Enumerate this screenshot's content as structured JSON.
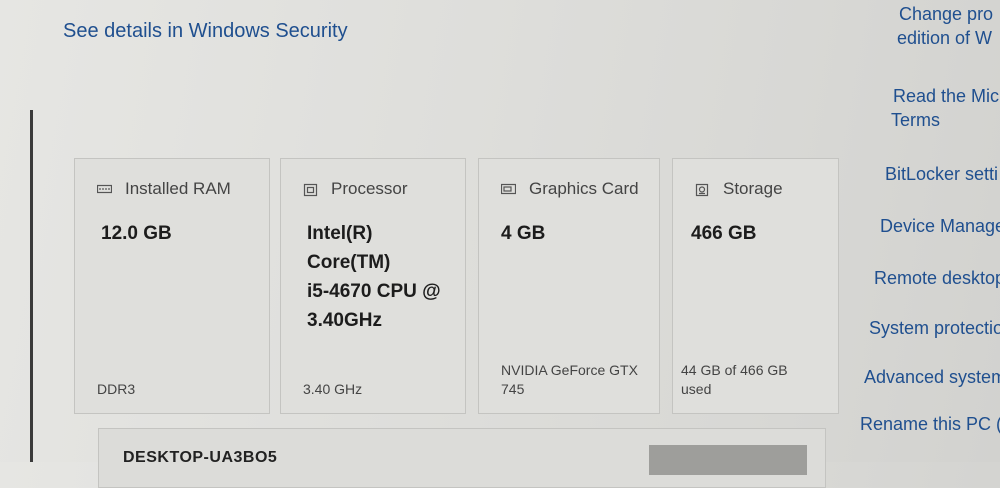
{
  "security_link": "See details in Windows Security",
  "cards": [
    {
      "icon": "ram-icon",
      "title": "Installed RAM",
      "value": "12.0 GB",
      "sub": "DDR3"
    },
    {
      "icon": "processor-icon",
      "title": "Processor",
      "value": "Intel(R)\nCore(TM)\ni5-4670 CPU @\n3.40GHz",
      "sub": "3.40 GHz"
    },
    {
      "icon": "graphics-card-icon",
      "title": "Graphics Card",
      "value": "4 GB",
      "sub": "NVIDIA GeForce GTX 745"
    },
    {
      "icon": "storage-icon",
      "title": "Storage",
      "value": "466 GB",
      "sub": "44 GB of 466 GB used"
    }
  ],
  "device": {
    "name": "DESKTOP-UA3BO5"
  },
  "related_links": [
    "Change product key or upgrade your edition of Windows",
    "Read the Microsoft Services Agreement",
    "Terms",
    "BitLocker settings",
    "Device Manager",
    "Remote desktop",
    "System protection",
    "Advanced system settings",
    "Rename this PC (advanced)"
  ],
  "related_links_visible": [
    "Change pro",
    "edition of W",
    "Read the Mic",
    "Terms",
    "BitLocker setti",
    "Device Manage",
    "Remote desktop",
    "System protectio",
    "Advanced system",
    "Rename this PC (a"
  ]
}
